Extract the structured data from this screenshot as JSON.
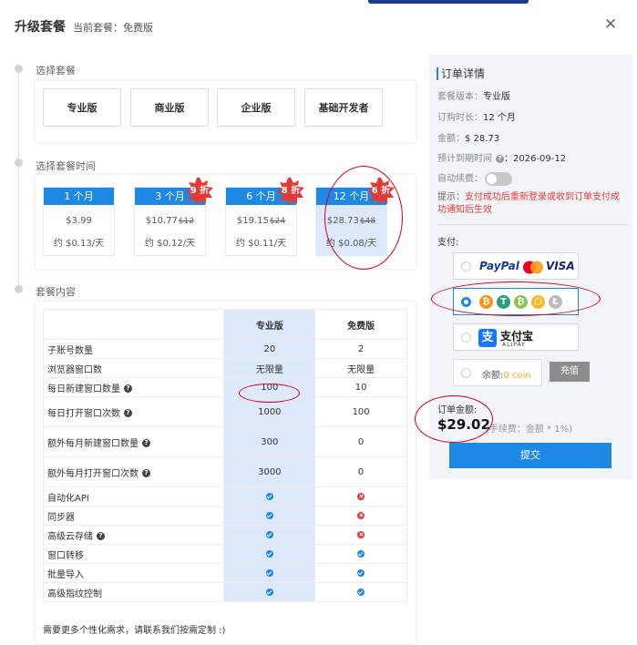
{
  "dialog": {
    "title": "升级套餐",
    "current_plan": "当前套餐：免费版",
    "close_glyph": "✕"
  },
  "steps": {
    "choose_plan": "选择套餐",
    "choose_duration": "选择套餐时间",
    "plan_content": "套餐内容"
  },
  "plans": [
    {
      "label": "专业版",
      "selected": true
    },
    {
      "label": "商业版",
      "selected": false
    },
    {
      "label": "企业版",
      "selected": false
    },
    {
      "label": "基础开发者",
      "selected": false
    }
  ],
  "durations": [
    {
      "label": "1 个月",
      "price": "$3.99",
      "original": "",
      "per_day": "约 $0.13/天",
      "discount": "",
      "selected": false
    },
    {
      "label": "3 个月",
      "price": "$10.77",
      "original": "$12",
      "per_day": "约 $0.12/天",
      "discount": "9 折",
      "selected": false
    },
    {
      "label": "6 个月",
      "price": "$19.15",
      "original": "$24",
      "per_day": "约 $0.11/天",
      "discount": "8 折",
      "selected": false
    },
    {
      "label": "12 个月",
      "price": "$28.73",
      "original": "$48",
      "per_day": "约 $0.08/天",
      "discount": "6 折",
      "selected": true
    }
  ],
  "table": {
    "headers": [
      "",
      "专业版",
      "免费版"
    ],
    "rows": [
      {
        "name": "子账号数量",
        "pro": "20",
        "free": "2",
        "help": false
      },
      {
        "name": "浏览器窗口数",
        "pro": "无限量",
        "free": "无限量",
        "help": false
      },
      {
        "name": "每日新建窗口数量",
        "pro": "100",
        "free": "10",
        "help": true
      },
      {
        "name": "每日打开窗口次数",
        "pro": "1000",
        "free": "100",
        "help": true
      },
      {
        "name": "额外每月新建窗口数量",
        "pro": "300",
        "free": "0",
        "help": true
      },
      {
        "name": "额外每月打开窗口次数",
        "pro": "3000",
        "free": "0",
        "help": true
      },
      {
        "name": "自动化API",
        "pro": "yes",
        "free": "no",
        "help": false
      },
      {
        "name": "同步器",
        "pro": "yes",
        "free": "no",
        "help": false
      },
      {
        "name": "高级云存储",
        "pro": "yes",
        "free": "no",
        "help": true
      },
      {
        "name": "窗口转移",
        "pro": "yes",
        "free": "yes",
        "help": false
      },
      {
        "name": "批量导入",
        "pro": "yes",
        "free": "yes",
        "help": false
      },
      {
        "name": "高级指纹控制",
        "pro": "yes",
        "free": "yes",
        "help": false
      }
    ],
    "footnote": "需要更多个性化需求，请联系我们按需定制 :)"
  },
  "order": {
    "title": "订单详情",
    "version_label": "套餐版本：",
    "version_value": "专业版",
    "duration_label": "订购时长：",
    "duration_value": "12 个月",
    "amount_label": "金额：",
    "amount_value": "$ 28.73",
    "expire_label": "预计到期时间",
    "expire_value": "：2026-09-12",
    "auto_renew_label": "自动续费：",
    "auto_renew_on": false,
    "notice_prefix": "提示：",
    "notice_text": "支付成功后重新登录或收到订单支付成功通知后生效",
    "pay_label": "支付:",
    "payment_methods": [
      {
        "id": "paypal-visa",
        "paypal": "PayPal",
        "visa": "VISA",
        "selected": false
      },
      {
        "id": "crypto",
        "coins": [
          "₿",
          "T",
          "₿",
          "⬡",
          "Ł"
        ],
        "selected": true
      },
      {
        "id": "alipay",
        "name": "支付宝",
        "sub": "ALIPAY",
        "selected": false
      }
    ],
    "balance_label": "余额:",
    "balance_value": "0 coin",
    "recharge_label": "充值",
    "total_label": "订单金额:",
    "total_value": "$29.02",
    "fee_text": "(手续费：金额 * 1%)",
    "submit_label": "提交"
  },
  "colors": {
    "primary": "#1e88e5",
    "badge_red": "#e53935",
    "annotation_red": "#d0021b",
    "highlight_blue": "#dde9fb"
  }
}
